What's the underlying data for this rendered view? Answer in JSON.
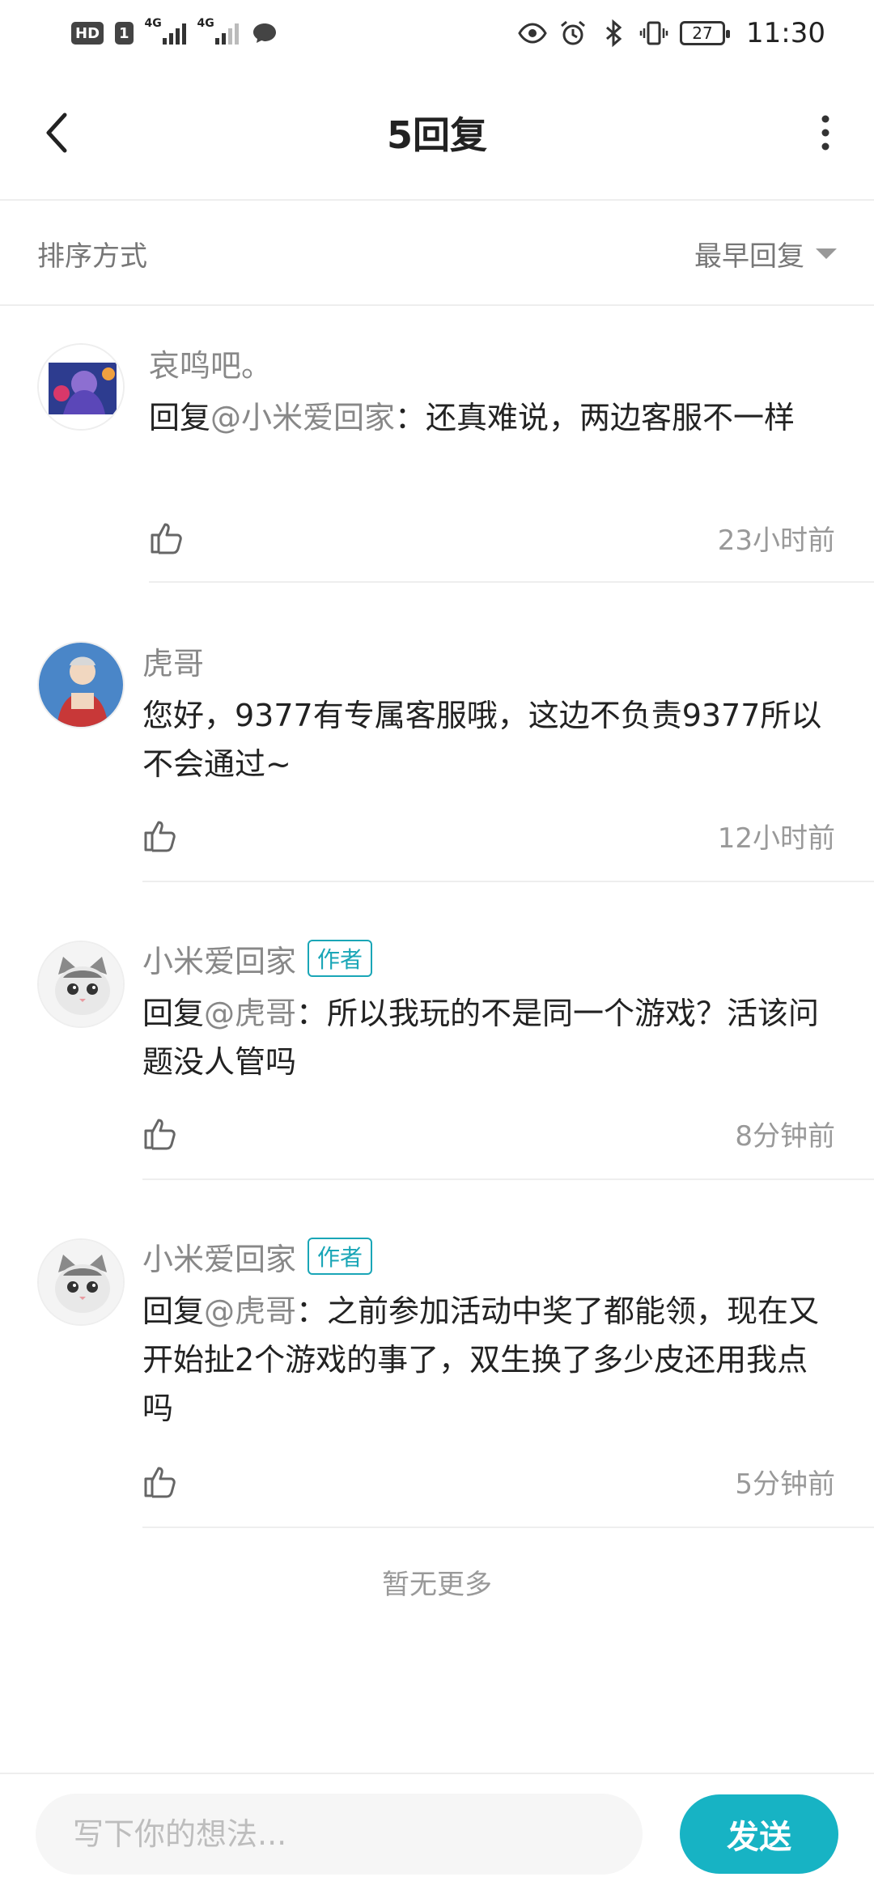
{
  "status_bar": {
    "hd_label": "HD",
    "sim_label": "1",
    "net1": "4G",
    "net2": "4G",
    "battery_level": "27",
    "time": "11:30"
  },
  "header": {
    "title": "5回复"
  },
  "sort": {
    "label": "排序方式",
    "value": "最早回复"
  },
  "comments": [
    {
      "name": "哀鸣吧。",
      "is_author": false,
      "author_tag": "",
      "prefix": "回复",
      "mention": "@小米爱回家",
      "text": "：还真难说，两边客服不一样",
      "time": "23小时前",
      "avatar": "game-character-avatar"
    },
    {
      "name": "虎哥",
      "is_author": false,
      "author_tag": "",
      "prefix": "",
      "mention": "",
      "text": "您好，9377有专属客服哦，这边不负责9377所以不会通过~",
      "time": "12小时前",
      "avatar": "warrior-avatar"
    },
    {
      "name": "小米爱回家",
      "is_author": true,
      "author_tag": "作者",
      "prefix": "回复",
      "mention": "@虎哥",
      "text": "：所以我玩的不是同一个游戏？活该问题没人管吗",
      "time": "8分钟前",
      "avatar": "cat-avatar"
    },
    {
      "name": "小米爱回家",
      "is_author": true,
      "author_tag": "作者",
      "prefix": "回复",
      "mention": "@虎哥",
      "text": "：之前参加活动中奖了都能领，现在又开始扯2个游戏的事了，双生换了多少皮还用我点吗",
      "time": "5分钟前",
      "avatar": "cat-avatar"
    }
  ],
  "no_more": "暂无更多",
  "composer": {
    "placeholder": "写下你的想法...",
    "send_label": "发送"
  },
  "colors": {
    "accent": "#17b3c4",
    "author_tag": "#1aa6b7",
    "muted_text": "#888888",
    "divider": "#eeeeee"
  }
}
